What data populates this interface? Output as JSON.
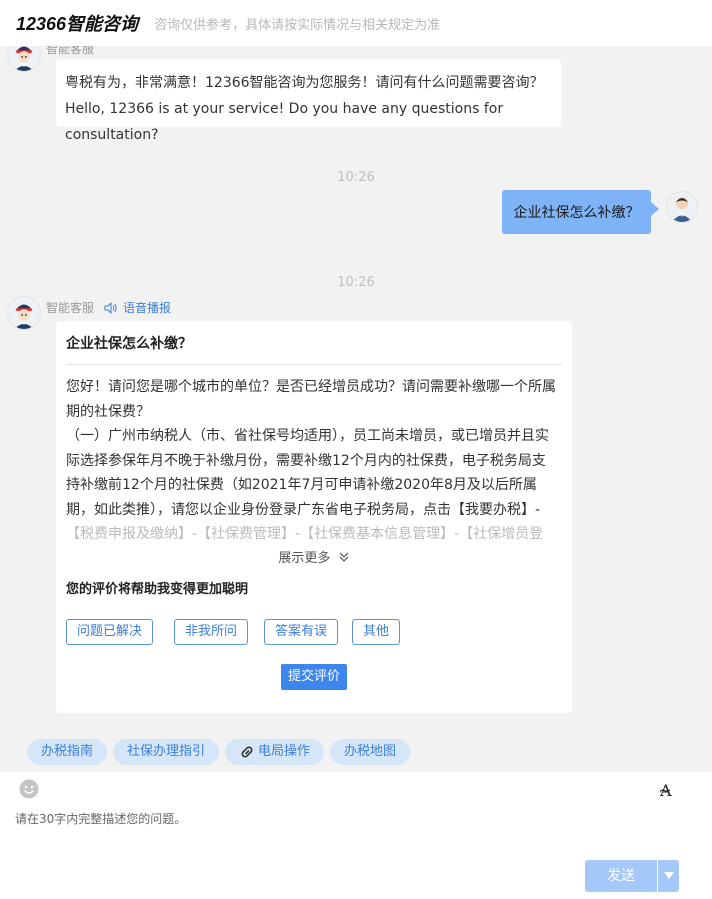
{
  "header": {
    "title": "12366智能咨询",
    "subtitle": "咨询仅供参考，具体请按实际情况与相关规定为准"
  },
  "greeting": {
    "bot_name": "智能客服",
    "line1": "粤税有为，非常满意！12366智能咨询为您服务！请问有什么问题需要咨询？",
    "line2": "Hello, 12366 is at your service! Do you have any questions for consultation?"
  },
  "timestamps": [
    "10:26",
    "10:26"
  ],
  "user_message": "企业社保怎么补缴？",
  "answer": {
    "bot_name": "智能客服",
    "tts_label": "语音播报",
    "title": "企业社保怎么补缴？",
    "para1": "您好！请问您是哪个城市的单位？是否已经增员成功？请问需要补缴哪一个所属期的社保费？",
    "para2": "（一）广州市纳税人（市、省社保号均适用），员工尚未增员，或已增员并且实际选择参保年月不晚于补缴月份，需要补缴12个月内的社保费，电子税务局支持补缴前12个月的社保费（如2021年7月可申请补缴2020年8月及以后所属期，如此类推），请您以企业身份登录广东省电子税务局，点击【我要办税】-",
    "para_faded": "【税费申报及缴纳】-【社保费管理】-【社保费基本信息管理】-【社保增员登",
    "show_more": "展示更多",
    "rate_heading": "您的评价将帮助我变得更加聪明",
    "rate_options": [
      "问题已解决",
      "非我所问",
      "答案有误",
      "其他"
    ],
    "submit": "提交评价"
  },
  "quick_links": [
    "办税指南",
    "社保办理指引",
    "电局操作",
    "办税地图"
  ],
  "input": {
    "placeholder": "请在30字内完整描述您的问题。",
    "send_label": "发送"
  },
  "icons": {
    "emoji": "emoji-icon",
    "font_size": "font-size-icon",
    "speaker": "speaker-icon",
    "link": "link-icon",
    "dropdown": "chevron-down-icon"
  },
  "colors": {
    "accent": "#3c86ee",
    "user_bubble": "#7eb4f7",
    "chat_bg": "#f2f2f2",
    "quick_link_bg": "#d5e6f8",
    "send_button": "#a4c8f7"
  }
}
